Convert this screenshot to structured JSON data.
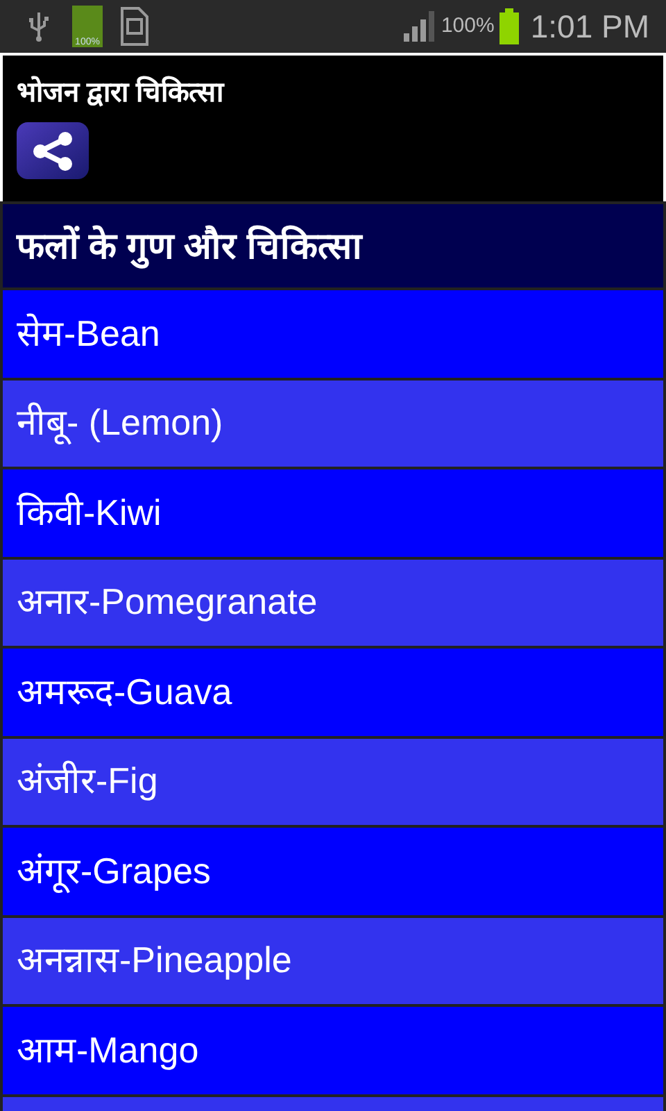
{
  "status_bar": {
    "battery_app_label": "100%",
    "battery_percent": "100%",
    "time": "1:01 PM"
  },
  "header": {
    "title": "भोजन द्वारा चिकित्सा"
  },
  "section_heading": "फलों के गुण और चिकित्सा",
  "items": [
    {
      "label": "सेम-Bean"
    },
    {
      "label": "नीबू- (Lemon)"
    },
    {
      "label": "किवी-Kiwi"
    },
    {
      "label": "अनार-Pomegranate"
    },
    {
      "label": "अमरूद-Guava"
    },
    {
      "label": "अंजीर-Fig"
    },
    {
      "label": "अंगूर-Grapes"
    },
    {
      "label": "अनन्नास-Pineapple"
    },
    {
      "label": "आम-Mango"
    }
  ]
}
